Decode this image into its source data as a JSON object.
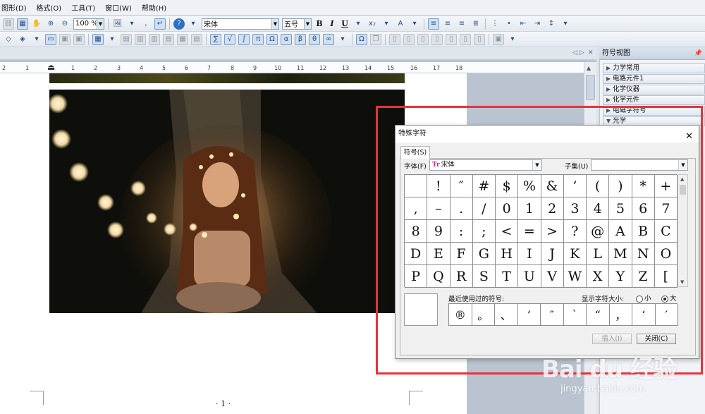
{
  "menu": [
    "图形(D)",
    "格式(O)",
    "工具(T)",
    "窗口(W)",
    "帮助(H)"
  ],
  "toolbar": {
    "zoom": "100 %",
    "font_name": "宋体",
    "font_size": "五号",
    "bold": "B",
    "italic": "I",
    "underline": "U"
  },
  "ruler_ticks": [
    "2",
    "1",
    "1",
    "2",
    "3",
    "4",
    "5",
    "6",
    "7",
    "8",
    "9",
    "10",
    "11",
    "12",
    "13",
    "14",
    "15",
    "16",
    "17",
    "18"
  ],
  "document": {
    "page_number": "· 1 ·"
  },
  "symbol_panel": {
    "title": "符号视图",
    "categories": [
      "力学常用",
      "电路元件1",
      "化学仪器",
      "化学元件",
      "电磁学符号",
      "光学"
    ]
  },
  "dialog": {
    "title": "特殊字符",
    "close_glyph": "✕",
    "tab": "符号(S)",
    "font_label": "字体(F)",
    "font_value": "宋体",
    "font_icon_glyph": "Tr",
    "subset_label": "子集(U)",
    "subset_value": "",
    "grid": [
      [
        "",
        "!",
        "″",
        "#",
        "$",
        "%",
        "&",
        "’",
        "(",
        ")",
        "*",
        "+"
      ],
      [
        ",",
        "–",
        ".",
        "/",
        "0",
        "1",
        "2",
        "3",
        "4",
        "5",
        "6",
        "7"
      ],
      [
        "8",
        "9",
        ":",
        ";",
        "<",
        "=",
        ">",
        "?",
        "@",
        "A",
        "B",
        "C"
      ],
      [
        "D",
        "E",
        "F",
        "G",
        "H",
        "I",
        "J",
        "K",
        "L",
        "M",
        "N",
        "O"
      ],
      [
        "P",
        "Q",
        "R",
        "S",
        "T",
        "U",
        "V",
        "W",
        "X",
        "Y",
        "Z",
        "["
      ]
    ],
    "recent_label": "最近使用过的符号:",
    "recent": [
      "®",
      "。",
      "、",
      "’",
      "″",
      "`",
      "“",
      "，",
      "‘",
      "′"
    ],
    "size_label": "显示字符大小:",
    "size_small": "小",
    "size_large": "大",
    "size_selected": "大",
    "insert_button": "插入(I)",
    "close_button": "关闭(C)"
  },
  "watermark": {
    "main": "Bai du 经验",
    "sub": "jingyan.baidu.com"
  }
}
